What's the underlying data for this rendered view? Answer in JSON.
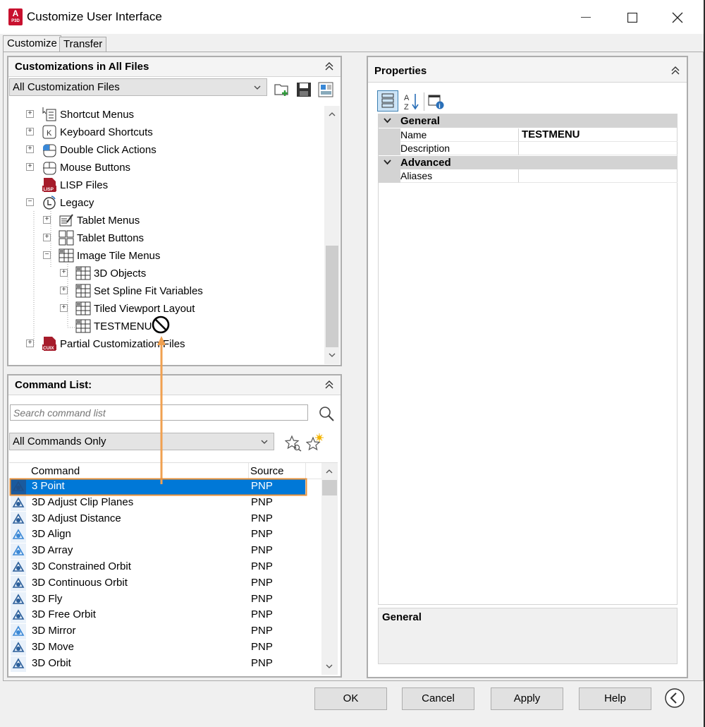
{
  "window": {
    "title": "Customize User Interface",
    "app_icon_letter": "A",
    "app_icon_sub": "P3D",
    "minimize": "—",
    "maximize": "☐",
    "close": "✕"
  },
  "tabs": [
    {
      "label": "Customize",
      "active": true
    },
    {
      "label": "Transfer",
      "active": false
    }
  ],
  "customizations": {
    "header": "Customizations in All Files",
    "filter_value": "All Customization Files",
    "tree": [
      {
        "label": "Shortcut Menus",
        "icon": "shortcut-menus-icon",
        "expander": "+"
      },
      {
        "label": "Keyboard Shortcuts",
        "icon": "keyboard-icon",
        "expander": "+"
      },
      {
        "label": "Double Click Actions",
        "icon": "double-click-icon",
        "expander": "+"
      },
      {
        "label": "Mouse Buttons",
        "icon": "mouse-icon",
        "expander": "+"
      },
      {
        "label": "LISP Files",
        "icon": "lisp-file-icon",
        "expander": ""
      },
      {
        "label": "Legacy",
        "icon": "legacy-icon",
        "expander": "−"
      },
      {
        "label": "Tablet Menus",
        "icon": "tablet-menu-icon",
        "expander": "+"
      },
      {
        "label": "Tablet Buttons",
        "icon": "tablet-buttons-icon",
        "expander": "+"
      },
      {
        "label": "Image Tile Menus",
        "icon": "image-tile-icon",
        "expander": "−"
      },
      {
        "label": "3D Objects",
        "icon": "image-tile-icon",
        "expander": "+"
      },
      {
        "label": "Set Spline Fit Variables",
        "icon": "image-tile-icon",
        "expander": "+"
      },
      {
        "label": "Tiled Viewport Layout",
        "icon": "image-tile-icon",
        "expander": "+"
      },
      {
        "label": "TESTMENU",
        "icon": "image-tile-icon",
        "expander": ""
      },
      {
        "label": "Partial Customization Files",
        "icon": "cuix-file-icon",
        "expander": "+"
      }
    ],
    "lisp_badge": "LISP",
    "cuix_badge": "CUIX"
  },
  "command_list": {
    "header": "Command List:",
    "search_placeholder": "Search command list",
    "filter_value": "All Commands Only",
    "col_command": "Command",
    "col_source": "Source",
    "rows": [
      {
        "name": "3 Point",
        "source": "PNP",
        "selected": true,
        "icon_text": "3"
      },
      {
        "name": "3D Adjust Clip Planes",
        "source": "PNP"
      },
      {
        "name": "3D Adjust Distance",
        "source": "PNP"
      },
      {
        "name": "3D Align",
        "source": "PNP"
      },
      {
        "name": "3D Array",
        "source": "PNP"
      },
      {
        "name": "3D Constrained Orbit",
        "source": "PNP"
      },
      {
        "name": "3D Continuous Orbit",
        "source": "PNP"
      },
      {
        "name": "3D Fly",
        "source": "PNP"
      },
      {
        "name": "3D Free Orbit",
        "source": "PNP"
      },
      {
        "name": "3D Mirror",
        "source": "PNP"
      },
      {
        "name": "3D Move",
        "source": "PNP"
      },
      {
        "name": "3D Orbit",
        "source": "PNP"
      }
    ]
  },
  "properties": {
    "header": "Properties",
    "categories": [
      {
        "label": "General",
        "rows": [
          {
            "name": "Name",
            "value": "TESTMENU"
          },
          {
            "name": "Description",
            "value": ""
          }
        ]
      },
      {
        "label": "Advanced",
        "rows": [
          {
            "name": "Aliases",
            "value": ""
          }
        ]
      }
    ],
    "description_title": "General"
  },
  "buttons": {
    "ok": "OK",
    "cancel": "Cancel",
    "apply": "Apply",
    "help": "Help"
  },
  "colors": {
    "selection": "#0078d7",
    "drag_arrow": "#f0a050",
    "drag_box": "#e8913a",
    "app_red": "#c8102e"
  }
}
